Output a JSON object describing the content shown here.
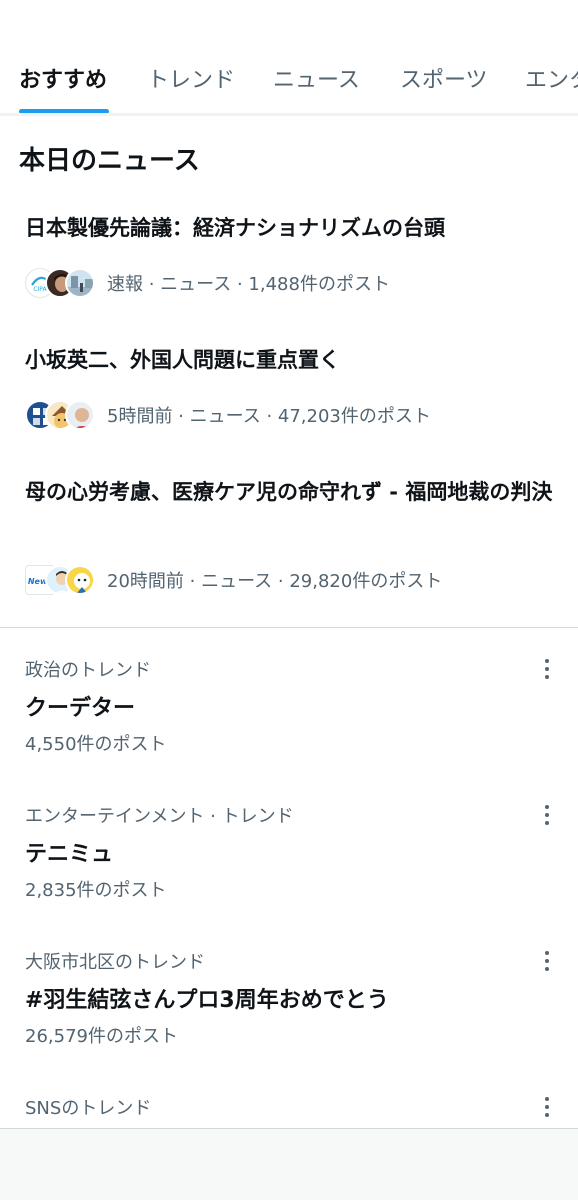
{
  "tabs": [
    {
      "label": "おすすめ",
      "active": true
    },
    {
      "label": "トレンド",
      "active": false
    },
    {
      "label": "ニュース",
      "active": false
    },
    {
      "label": "スポーツ",
      "active": false
    },
    {
      "label": "エンタ",
      "active": false
    }
  ],
  "section_title": "本日のニュース",
  "news": [
    {
      "headline": "日本製優先論議：経済ナショナリズムの台頭",
      "meta": "速報 · ニュース · 1,488件のポスト",
      "avatar_icons": [
        "news-logo-icon",
        "person-photo-icon",
        "street-photo-icon"
      ]
    },
    {
      "headline": "小坂英二、外国人問題に重点置く",
      "meta": "5時間前 · ニュース · 47,203件のポスト",
      "avatar_icons": [
        "newspaper-logo-icon",
        "cartoon-character-icon",
        "person-photo-icon"
      ]
    },
    {
      "headline": "母の心労考慮、医療ケア児の命守れず - 福岡地裁の判決",
      "meta": "20時間前 · ニュース · 29,820件のポスト",
      "avatar_icons": [
        "news-brand-logo-icon",
        "doctor-illustration-icon",
        "cartoon-character-icon"
      ]
    }
  ],
  "trends": [
    {
      "category": "政治のトレンド",
      "name": "クーデター",
      "count": "4,550件のポスト"
    },
    {
      "category": "エンターテインメント · トレンド",
      "name": "テニミュ",
      "count": "2,835件のポスト"
    },
    {
      "category": "大阪市北区のトレンド",
      "name": "#羽生結弦さんプロ3周年おめでとう",
      "count": "26,579件のポスト"
    },
    {
      "category": "SNSのトレンド",
      "name": "",
      "count": ""
    }
  ],
  "colors": {
    "accent": "#1d9bf0",
    "text_primary": "#0f1419",
    "text_secondary": "#536471",
    "border": "#cfd9de"
  }
}
